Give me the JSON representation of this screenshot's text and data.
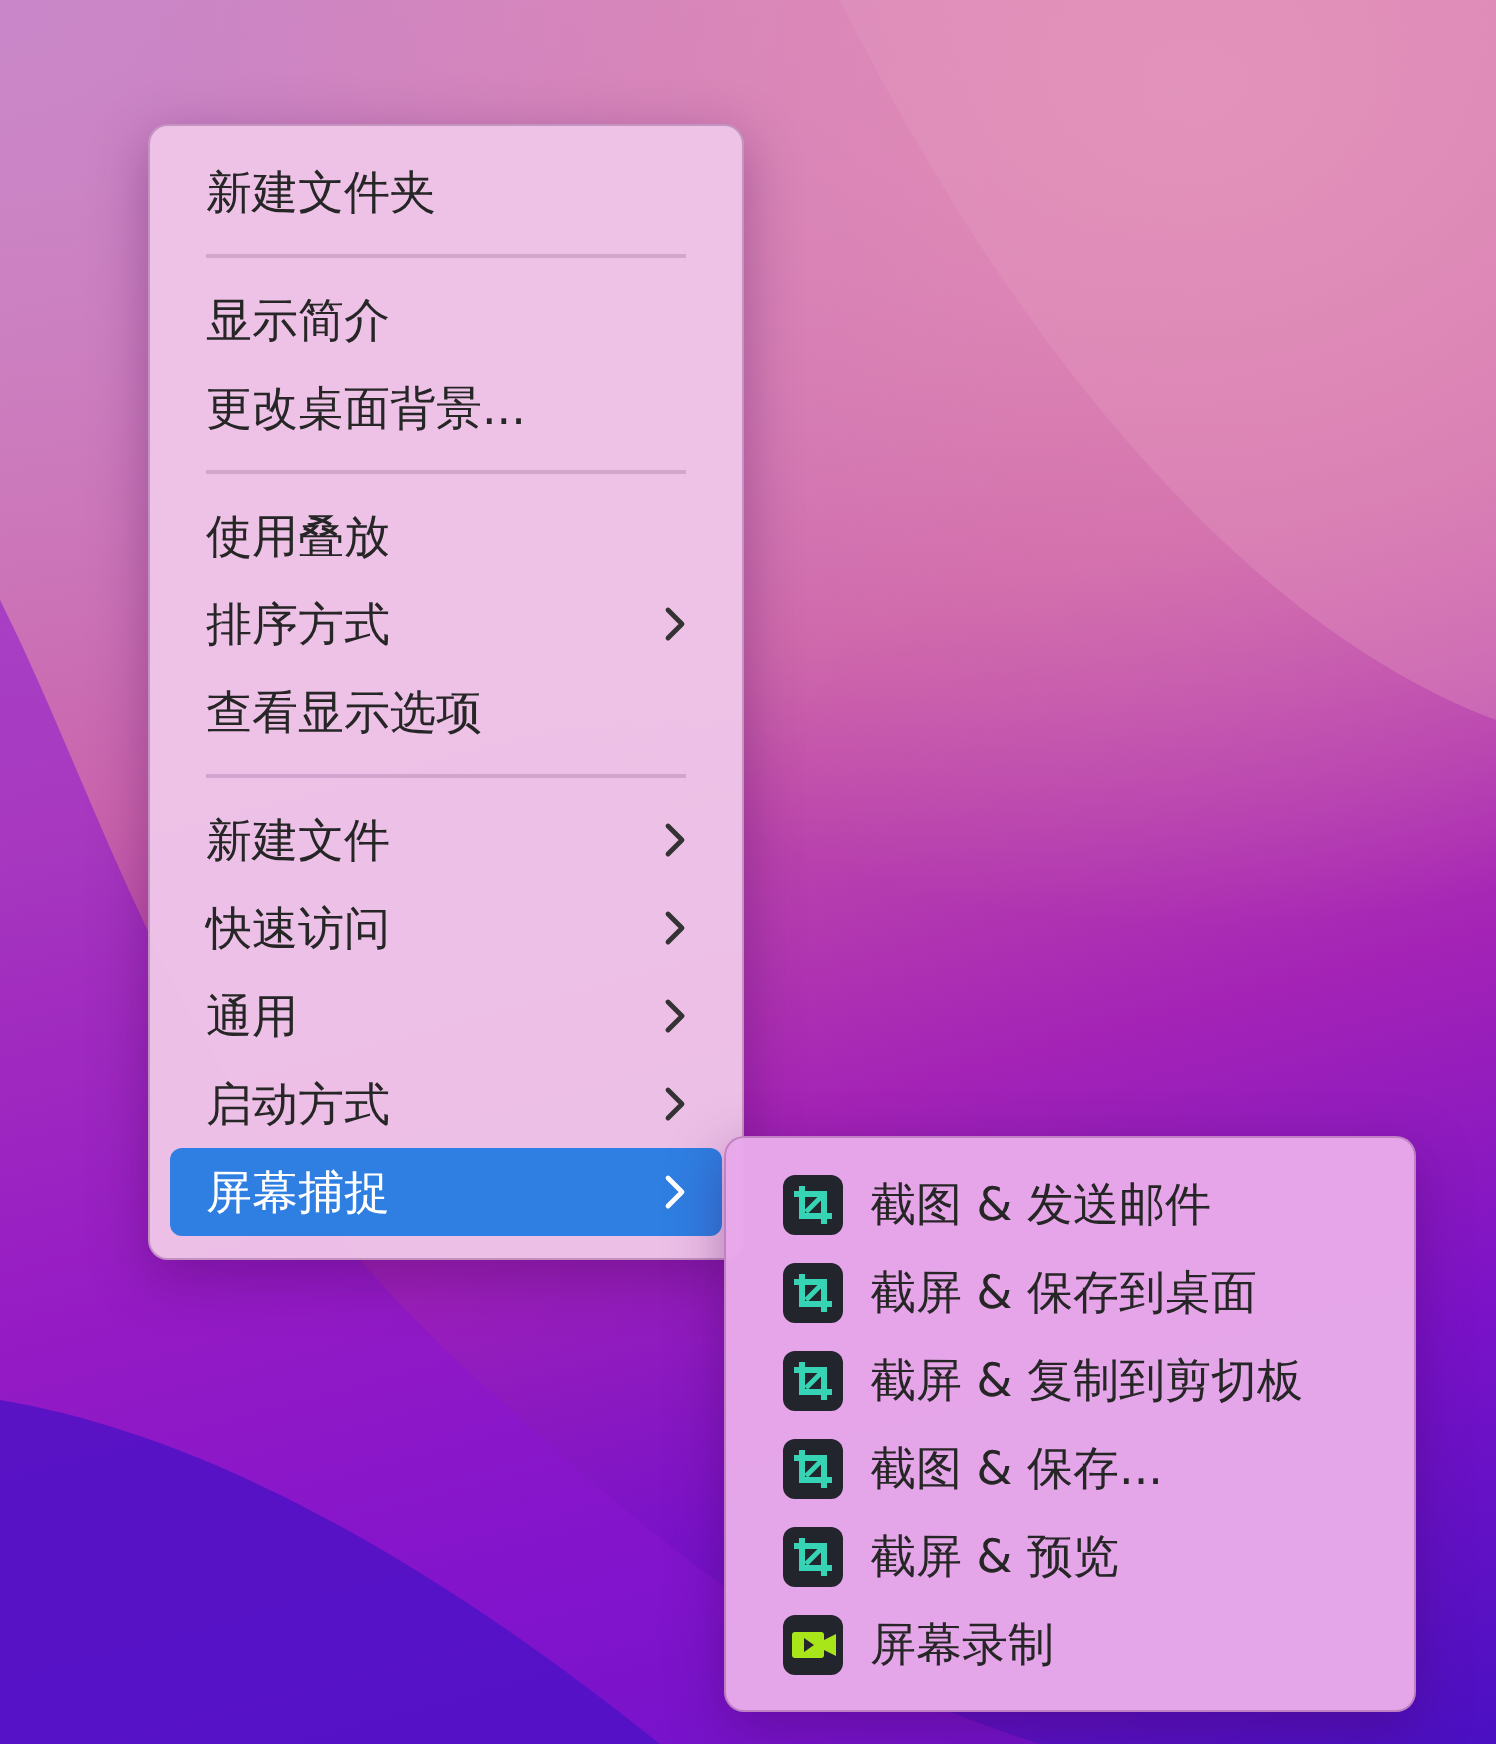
{
  "context_menu": {
    "groups": [
      {
        "items": [
          {
            "label": "新建文件夹",
            "has_submenu": false,
            "selected": false
          }
        ]
      },
      {
        "items": [
          {
            "label": "显示简介",
            "has_submenu": false,
            "selected": false
          },
          {
            "label": "更改桌面背景...",
            "has_submenu": false,
            "selected": false
          }
        ]
      },
      {
        "items": [
          {
            "label": "使用叠放",
            "has_submenu": false,
            "selected": false
          },
          {
            "label": "排序方式",
            "has_submenu": true,
            "selected": false
          },
          {
            "label": "查看显示选项",
            "has_submenu": false,
            "selected": false
          }
        ]
      },
      {
        "items": [
          {
            "label": "新建文件",
            "has_submenu": true,
            "selected": false
          },
          {
            "label": "快速访问",
            "has_submenu": true,
            "selected": false
          },
          {
            "label": "通用",
            "has_submenu": true,
            "selected": false
          },
          {
            "label": "启动方式",
            "has_submenu": true,
            "selected": false
          },
          {
            "label": "屏幕捕捉",
            "has_submenu": true,
            "selected": true
          }
        ]
      }
    ]
  },
  "submenu": {
    "items": [
      {
        "label": "截图 & 发送邮件",
        "kind": "crop"
      },
      {
        "label": "截屏 & 保存到桌面",
        "kind": "crop"
      },
      {
        "label": "截屏 & 复制到剪切板",
        "kind": "crop"
      },
      {
        "label": "截图 & 保存...",
        "kind": "crop"
      },
      {
        "label": "截屏 & 预览",
        "kind": "crop"
      },
      {
        "label": "屏幕录制",
        "kind": "record"
      }
    ]
  }
}
